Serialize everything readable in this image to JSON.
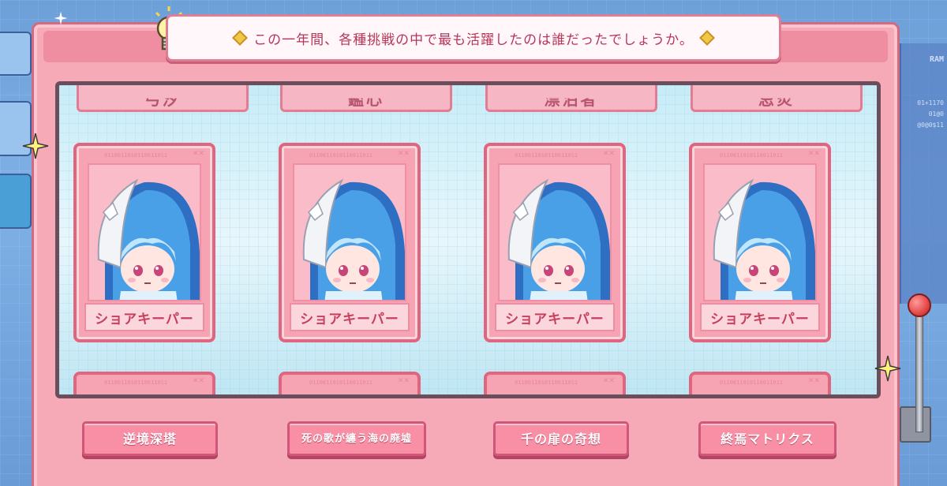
{
  "hint": {
    "text": "この一年間、各種挑戦の中で最も活躍したのは誰だったでしょうか。"
  },
  "reels": {
    "top_labels": [
      "弓汐",
      "鑑心",
      "漂泊者",
      "忌炎"
    ],
    "cards": [
      {
        "name": "ショアキーパー",
        "code": "0110011010110011011"
      },
      {
        "name": "ショアキーパー",
        "code": "0110011010110011011"
      },
      {
        "name": "ショアキーパー",
        "code": "0110011010110011011"
      },
      {
        "name": "ショアキーパー",
        "code": "0110011010110011011"
      }
    ],
    "bottom_codes": [
      "0110011010110011011",
      "0110011010110011011",
      "0110011010110011011",
      "0110011010110011011"
    ],
    "card_mark": "✕✕"
  },
  "buttons": [
    {
      "label": "逆境深塔"
    },
    {
      "label": "死の歌が纏う海の廃墟"
    },
    {
      "label": "千の扉の奇想"
    },
    {
      "label": "終焉マトリクス"
    }
  ],
  "side_panel": {
    "label": "RAM",
    "lines": [
      "01+1170",
      "01@0",
      "@0@0$11"
    ]
  },
  "colors": {
    "machine_pink": "#f6a9b6",
    "card_border": "#e0657f",
    "text_red": "#c6405f",
    "background_blue": "#7fb1e6"
  }
}
